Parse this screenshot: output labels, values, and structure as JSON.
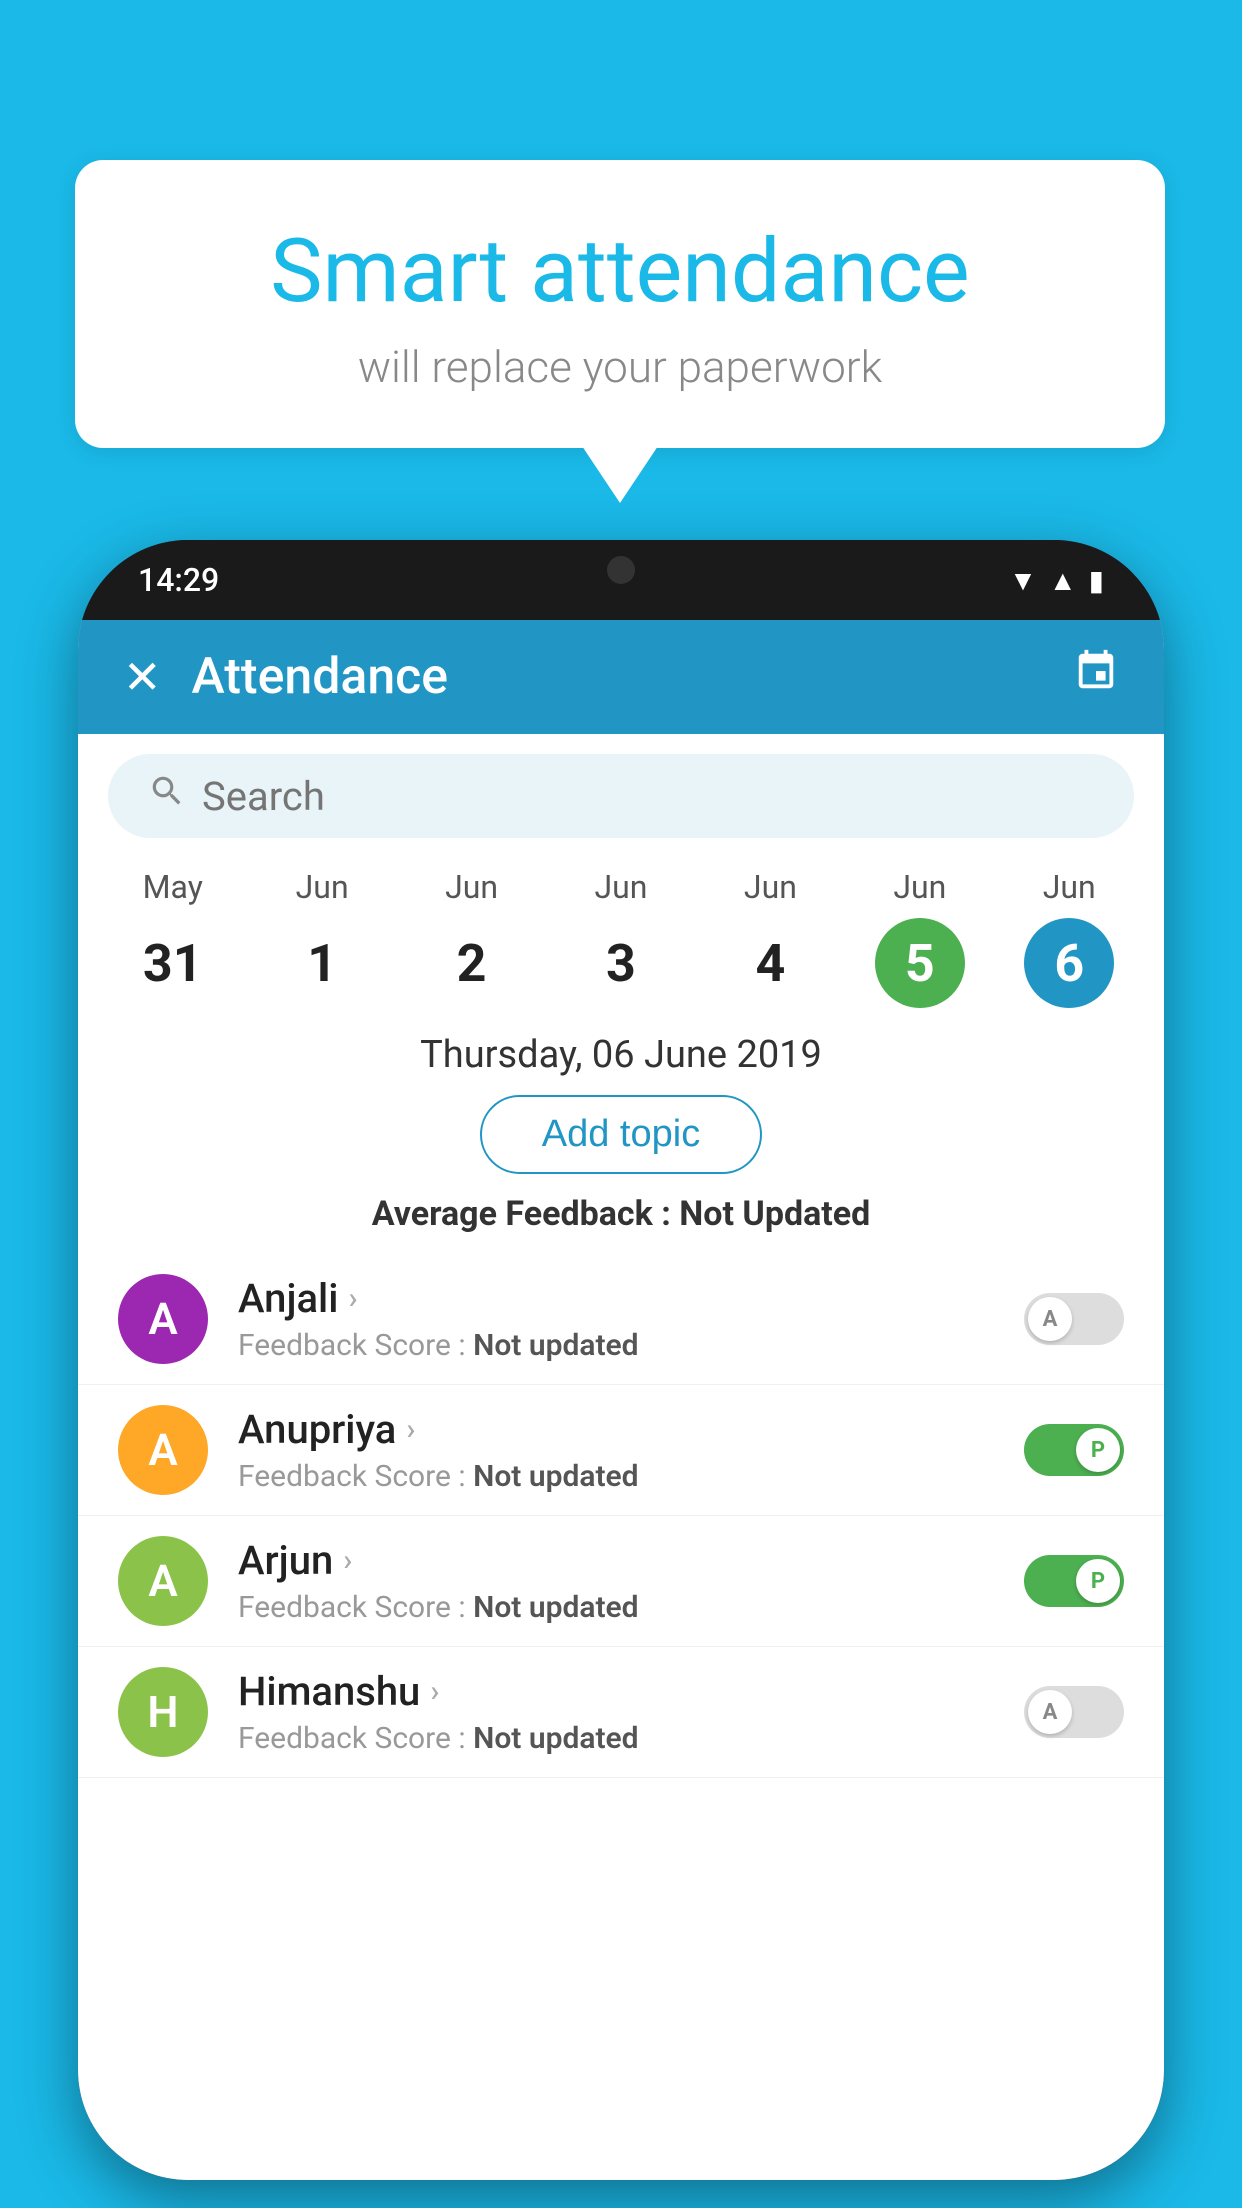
{
  "background_color": "#1ab9e8",
  "speech_bubble": {
    "title": "Smart attendance",
    "subtitle": "will replace your paperwork"
  },
  "phone": {
    "status_bar": {
      "time": "14:29"
    },
    "header": {
      "title": "Attendance",
      "close_label": "✕",
      "calendar_icon": "📅"
    },
    "search": {
      "placeholder": "Search"
    },
    "calendar": {
      "days": [
        {
          "month": "May",
          "num": "31",
          "state": "normal"
        },
        {
          "month": "Jun",
          "num": "1",
          "state": "normal"
        },
        {
          "month": "Jun",
          "num": "2",
          "state": "normal"
        },
        {
          "month": "Jun",
          "num": "3",
          "state": "normal"
        },
        {
          "month": "Jun",
          "num": "4",
          "state": "normal"
        },
        {
          "month": "Jun",
          "num": "5",
          "state": "today"
        },
        {
          "month": "Jun",
          "num": "6",
          "state": "selected"
        }
      ]
    },
    "date_heading": "Thursday, 06 June 2019",
    "add_topic_label": "Add topic",
    "avg_feedback_label": "Average Feedback : ",
    "avg_feedback_value": "Not Updated",
    "students": [
      {
        "name": "Anjali",
        "feedback": "Not updated",
        "avatar_letter": "A",
        "avatar_color": "#9c27b0",
        "toggle_state": "off",
        "toggle_label": "A"
      },
      {
        "name": "Anupriya",
        "feedback": "Not updated",
        "avatar_letter": "A",
        "avatar_color": "#ffa726",
        "toggle_state": "on",
        "toggle_label": "P"
      },
      {
        "name": "Arjun",
        "feedback": "Not updated",
        "avatar_letter": "A",
        "avatar_color": "#8bc34a",
        "toggle_state": "on",
        "toggle_label": "P"
      },
      {
        "name": "Himanshu",
        "feedback": "Not updated",
        "avatar_letter": "H",
        "avatar_color": "#8bc34a",
        "toggle_state": "off",
        "toggle_label": "A"
      }
    ],
    "feedback_score_prefix": "Feedback Score : "
  }
}
